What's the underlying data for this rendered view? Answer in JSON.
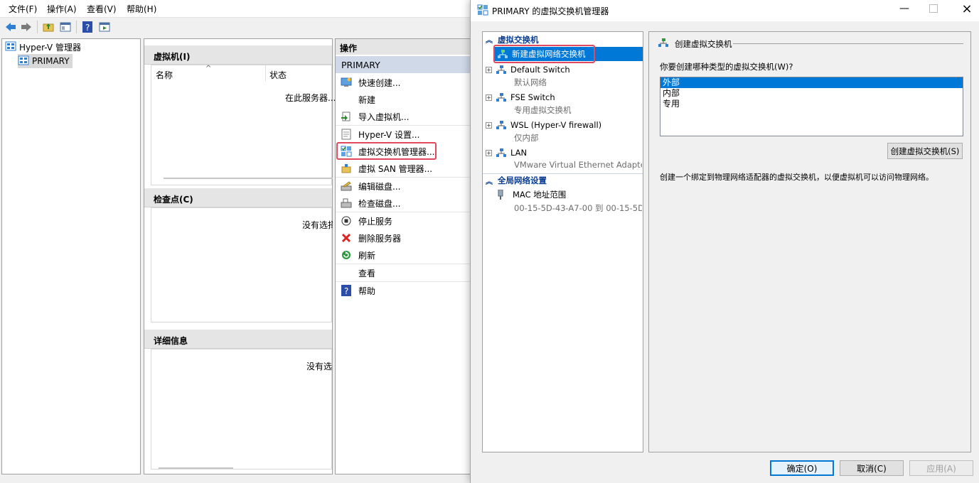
{
  "main": {
    "menu": [
      "文件(F)",
      "操作(A)",
      "查看(V)",
      "帮助(H)"
    ],
    "tree": {
      "root": "Hyper-V 管理器",
      "server": "PRIMARY"
    },
    "vm_section": {
      "title": "虚拟机(I)",
      "col_name": "名称",
      "col_state": "状态",
      "empty": "在此服务器..."
    },
    "checkpoint_section": {
      "title": "检查点(C)",
      "empty": "没有选择"
    },
    "details_section": {
      "title": "详细信息",
      "empty": "没有选"
    },
    "actions": {
      "header": "操作",
      "server": "PRIMARY",
      "items": [
        "快速创建...",
        "新建",
        "导入虚拟机...",
        "Hyper-V 设置...",
        "虚拟交换机管理器...",
        "虚拟 SAN 管理器...",
        "编辑磁盘...",
        "检查磁盘...",
        "停止服务",
        "删除服务器",
        "刷新",
        "查看",
        "帮助"
      ]
    }
  },
  "dialog": {
    "title": "PRIMARY 的虚拟交换机管理器",
    "tree": {
      "cat_switches": "虚拟交换机",
      "new_switch": "新建虚拟网络交换机",
      "switches": [
        {
          "name": "Default Switch",
          "sub": "默认网络"
        },
        {
          "name": "FSE Switch",
          "sub": "专用虚拟交换机"
        },
        {
          "name": "WSL (Hyper-V firewall)",
          "sub": "仅内部"
        },
        {
          "name": "LAN",
          "sub": "VMware Virtual Ethernet Adapte..."
        }
      ],
      "cat_global": "全局网络设置",
      "mac_name": "MAC 地址范围",
      "mac_sub": "00-15-5D-43-A7-00 到 00-15-5D..."
    },
    "panel": {
      "heading": "创建虚拟交换机",
      "question": "你要创建哪种类型的虚拟交换机(W)?",
      "options": [
        "外部",
        "内部",
        "专用"
      ],
      "selected": "外部",
      "create_button": "创建虚拟交换机(S)",
      "description": "创建一个绑定到物理网络适配器的虚拟交换机，以便虚拟机可以访问物理网络。"
    },
    "buttons": {
      "ok": "确定(O)",
      "cancel": "取消(C)",
      "apply": "应用(A)"
    }
  },
  "colors": {
    "highlight_box": "#e04a5c",
    "selection": "#0078d7",
    "category_text": "#0a3d91"
  }
}
